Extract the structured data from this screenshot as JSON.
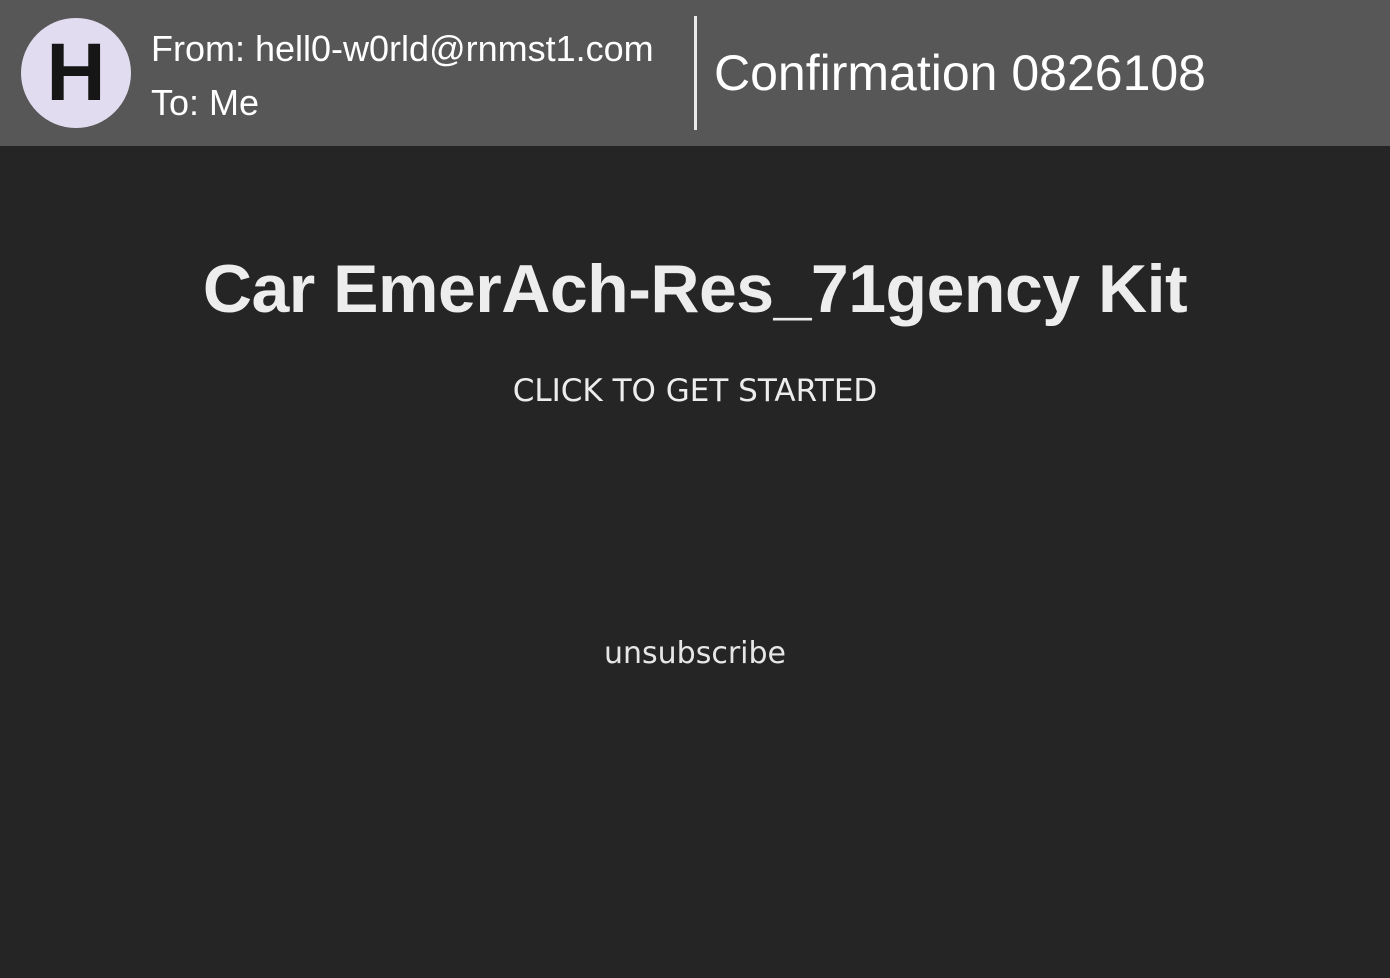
{
  "header": {
    "avatar_letter": "H",
    "from": "From: hell0-w0rld@rnmst1.com",
    "to": "To: Me",
    "subject": "Confirmation 0826108"
  },
  "body": {
    "title": "Car EmerAch-Res_71gency Kit",
    "cta": "CLICK TO GET STARTED",
    "unsubscribe": "unsubscribe"
  },
  "colors": {
    "header_bg": "#575757",
    "body_bg": "#252525",
    "avatar_bg": "#e2dcf0",
    "text": "#ffffff"
  }
}
